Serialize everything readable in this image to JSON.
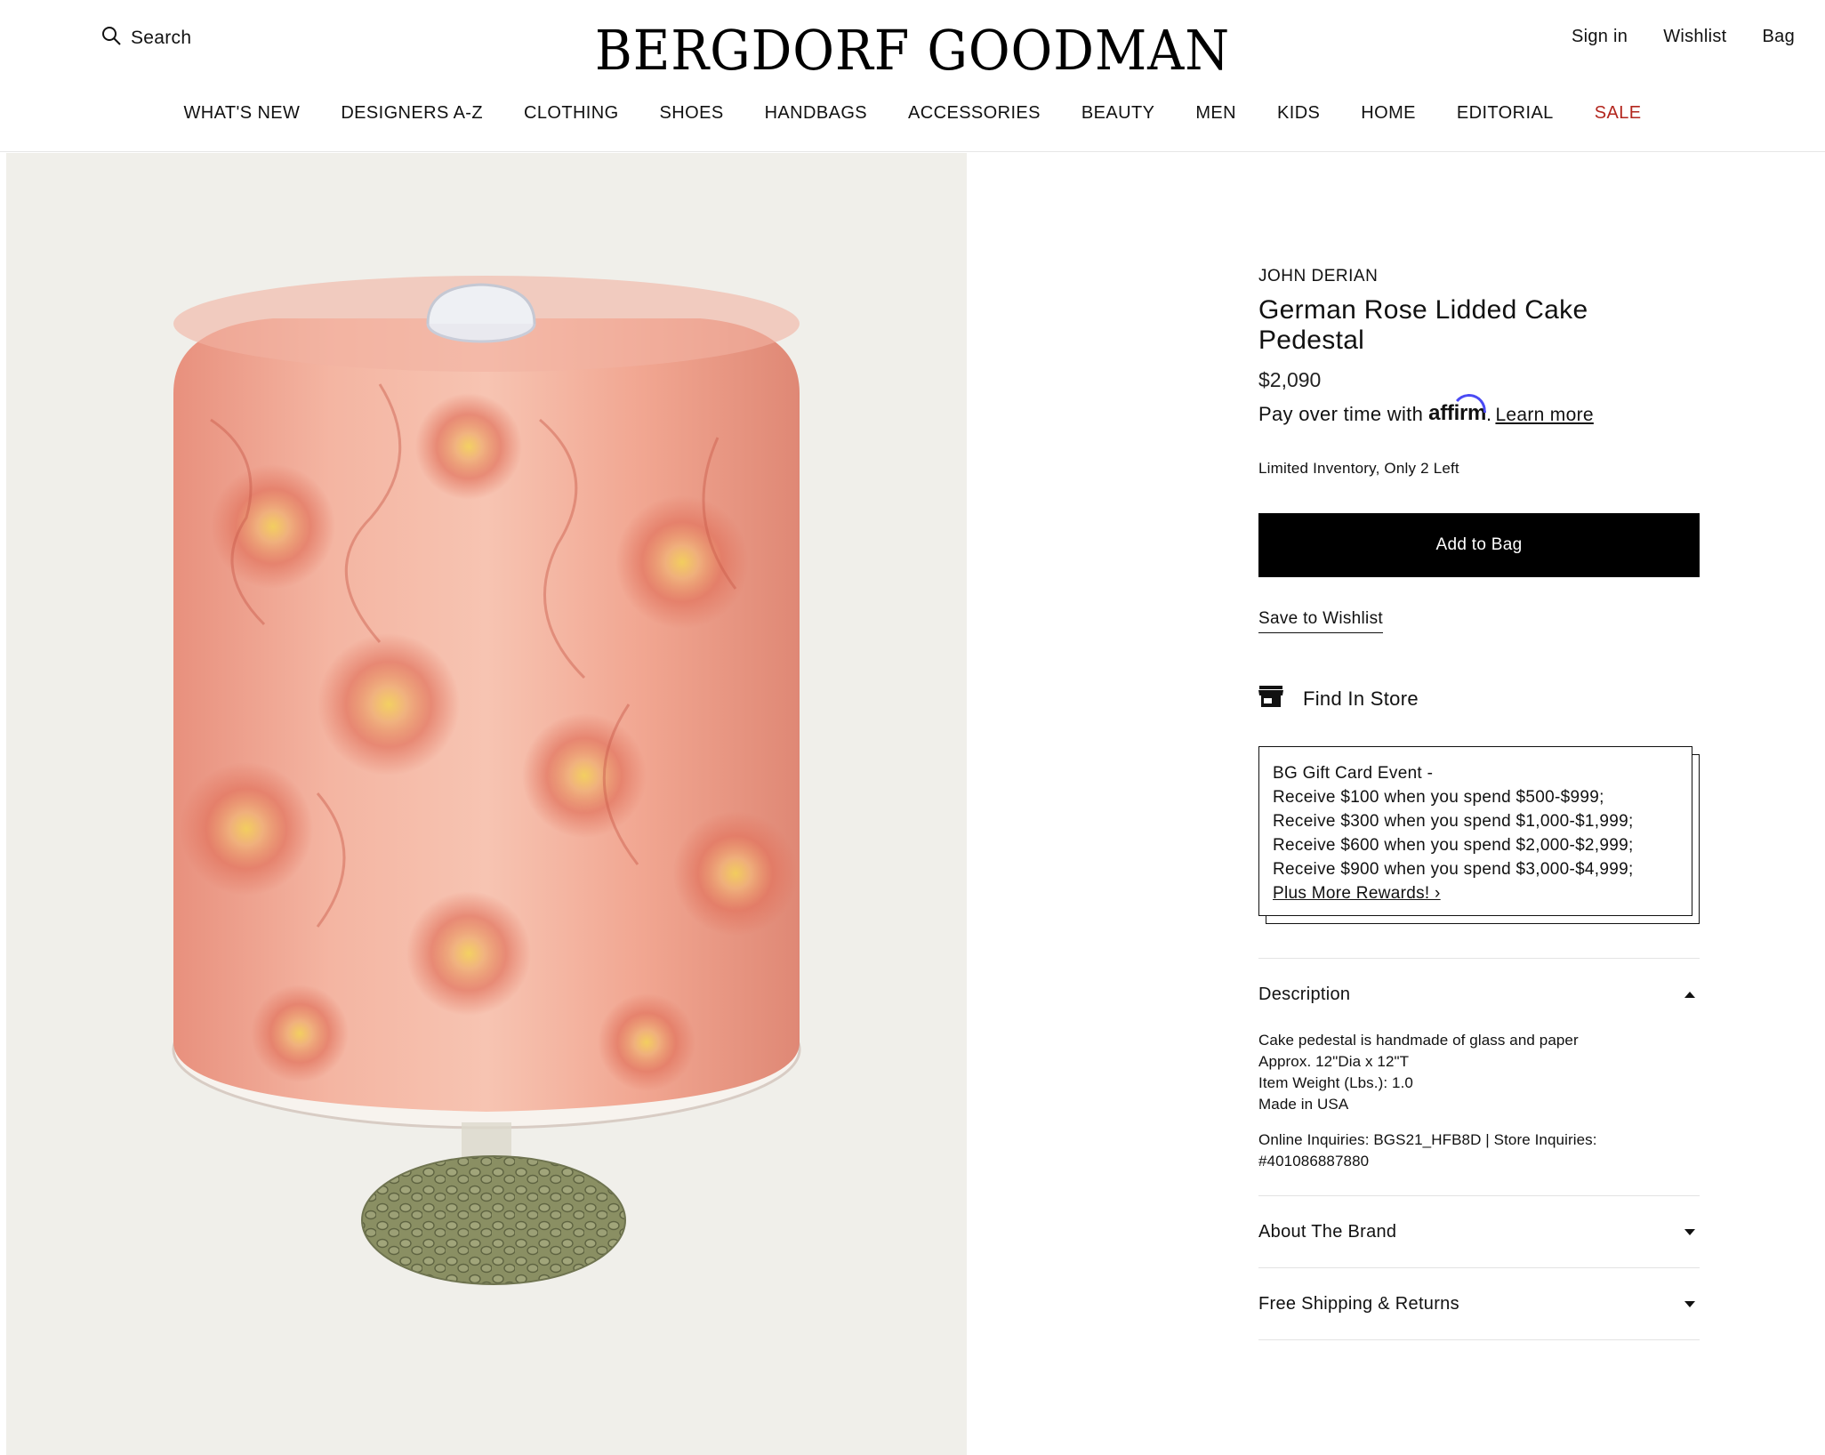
{
  "header": {
    "search_label": "Search",
    "logo": "BERGDORF GOODMAN",
    "sign_in": "Sign in",
    "wishlist": "Wishlist",
    "bag": "Bag"
  },
  "nav": {
    "items": [
      "WHAT'S NEW",
      "DESIGNERS A-Z",
      "CLOTHING",
      "SHOES",
      "HANDBAGS",
      "ACCESSORIES",
      "BEAUTY",
      "MEN",
      "KIDS",
      "HOME",
      "EDITORIAL",
      "SALE"
    ],
    "sale_color": "#b3261e"
  },
  "product": {
    "brand": "JOHN DERIAN",
    "title": "German Rose Lidded Cake Pedestal",
    "price": "$2,090",
    "affirm_prefix": "Pay over time with",
    "affirm_brand": "affirm",
    "affirm_suffix": ".",
    "learn_more": "Learn more",
    "inventory": "Limited Inventory, Only 2 Left",
    "add_to_bag": "Add to Bag",
    "save_wishlist": "Save to Wishlist",
    "find_in_store": "Find In Store"
  },
  "promo": {
    "lines": [
      "BG Gift Card Event -",
      "Receive $100 when you spend $500-$999;",
      "Receive $300 when you spend $1,000-$1,999;",
      "Receive $600 when you spend $2,000-$2,999;",
      "Receive $900 when you spend $3,000-$4,999;"
    ],
    "more": "Plus More Rewards! ›"
  },
  "accordion": {
    "description": {
      "label": "Description",
      "lines": [
        "Cake pedestal is handmade of glass and paper",
        "Approx. 12\"Dia x 12\"T",
        "Item Weight (Lbs.): 1.0",
        "Made in USA"
      ],
      "inquiries": "Online Inquiries: BGS21_HFB8D | Store Inquiries: #401086887880"
    },
    "about_brand": "About The Brand",
    "shipping": "Free Shipping & Returns"
  },
  "colors": {
    "accent_black": "#000000",
    "image_bg": "#f0efea",
    "affirm_blue": "#4a4af4"
  }
}
